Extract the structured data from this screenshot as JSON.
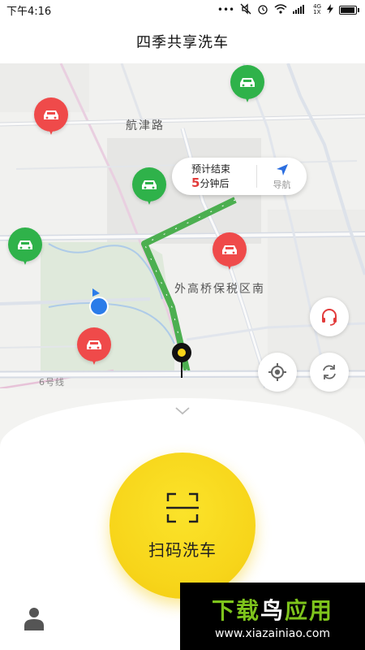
{
  "status_bar": {
    "time": "下午4:16",
    "signal_text": "4G",
    "signal_sub": "1X"
  },
  "header": {
    "title": "四季共享洗车"
  },
  "map": {
    "labels": {
      "road_1": "航津路",
      "area_1": "外高桥保税区南",
      "metro_line": "6号线"
    },
    "eta": {
      "line1": "预计结束",
      "minutes": "5",
      "line2_suffix": "分钟后",
      "nav_label": "导航"
    }
  },
  "scan_button": {
    "label": "扫码洗车"
  },
  "watermark": {
    "brand_green": "下载",
    "brand_white": "鸟",
    "brand_green2": "应用",
    "url": "www.xiazainiao.com"
  },
  "colors": {
    "accent_yellow": "#f7d51a",
    "route_green": "#4caf50",
    "pin_red": "#ef4a4a",
    "pin_green": "#2fb24a",
    "user_blue": "#2b7ce9"
  },
  "icons": [
    "wifi-icon",
    "battery-icon",
    "alarm-icon",
    "navigation-arrow-icon",
    "headset-icon",
    "locate-icon",
    "refresh-icon",
    "chevron-down-icon",
    "scan-icon",
    "user-icon",
    "car-icon"
  ]
}
